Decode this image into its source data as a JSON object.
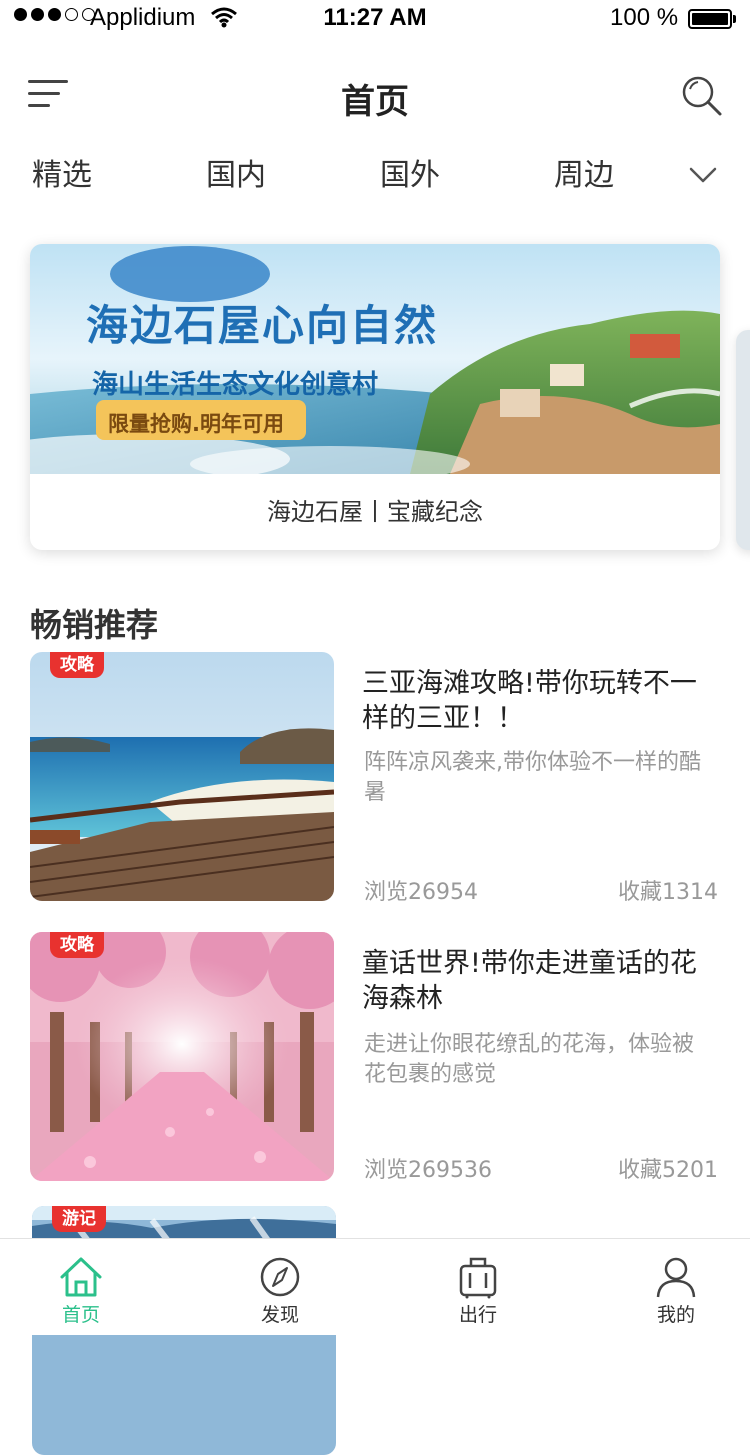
{
  "status_bar": {
    "carrier": "Applidium",
    "time": "11:27 AM",
    "battery": "100 %",
    "signal_dots_filled": 3,
    "signal_dots_total": 5
  },
  "header": {
    "title": "首页"
  },
  "tabs": [
    "精选",
    "国内",
    "国外",
    "周边"
  ],
  "banner": {
    "headline": "海边石屋心向自然",
    "subline": "海山生活生态文化创意村",
    "tag": "限量抢购.明年可用",
    "caption": "海边石屋丨宝藏纪念"
  },
  "section_title": "畅销推荐",
  "list": [
    {
      "badge": "攻略",
      "title": "三亚海滩攻略!带你玩转不一样的三亚！！",
      "desc": "阵阵凉风袭来,带你体验不一样的酷暑",
      "views": "浏览26954",
      "favorites": "收藏1314"
    },
    {
      "badge": "攻略",
      "title": "童话世界!带你走进童话的花海森林",
      "desc": "走进让你眼花缭乱的花海，体验被花包裹的感觉",
      "views": "浏览269536",
      "favorites": "收藏5201"
    },
    {
      "badge": "游记"
    }
  ],
  "tabbar": [
    {
      "label": "首页",
      "icon": "home-icon",
      "active": true
    },
    {
      "label": "发现",
      "icon": "compass-icon",
      "active": false
    },
    {
      "label": "出行",
      "icon": "suitcase-icon",
      "active": false
    },
    {
      "label": "我的",
      "icon": "user-icon",
      "active": false
    }
  ],
  "colors": {
    "accent": "#2bc08b",
    "badge": "#e8322f",
    "text": "#333333",
    "muted": "#999999"
  }
}
